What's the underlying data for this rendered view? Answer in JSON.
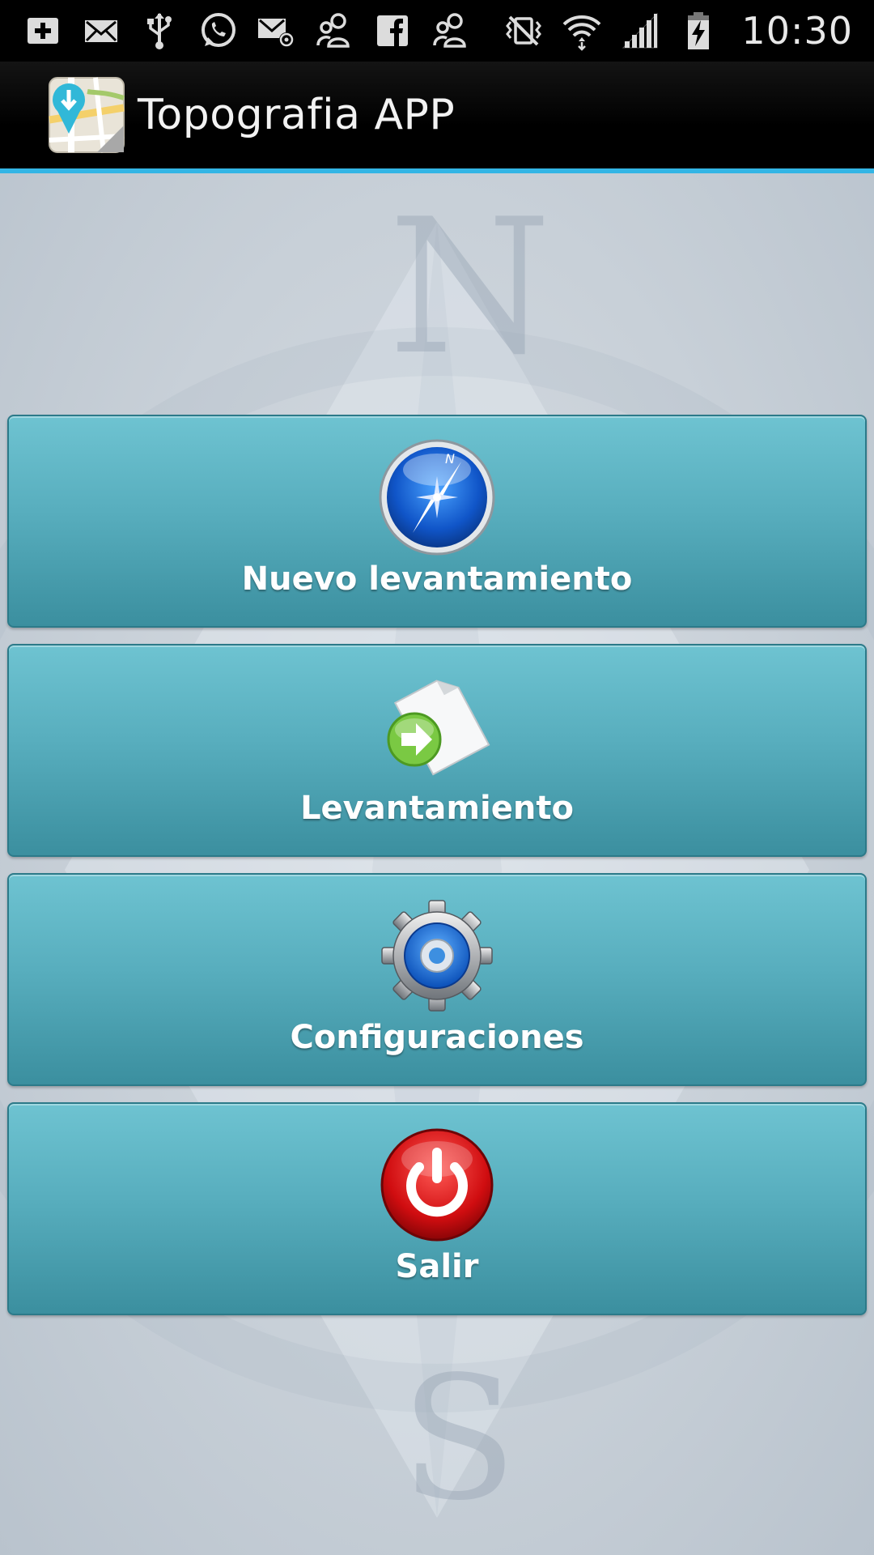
{
  "status_bar": {
    "time": "10:30",
    "left_icons": [
      "add-box-icon",
      "mail-icon",
      "usb-icon",
      "whatsapp-icon",
      "email-at-icon",
      "people-icon",
      "facebook-icon",
      "people-icon"
    ],
    "right_icons": [
      "vibrate-mute-icon",
      "wifi-icon",
      "signal-icon",
      "battery-charging-icon"
    ]
  },
  "action_bar": {
    "title": "Topografia APP",
    "icon": "map-pin-icon"
  },
  "menu": {
    "items": [
      {
        "label": "Nuevo levantamiento",
        "icon": "compass-icon"
      },
      {
        "label": "Levantamiento",
        "icon": "document-arrow-icon"
      },
      {
        "label": "Configuraciones",
        "icon": "gear-icon"
      },
      {
        "label": "Salir",
        "icon": "power-icon"
      }
    ]
  },
  "colors": {
    "accent": "#33b5e5",
    "button_top": "#6ec3d1",
    "button_bottom": "#3b8f9f",
    "background": "#cfd6dd"
  }
}
